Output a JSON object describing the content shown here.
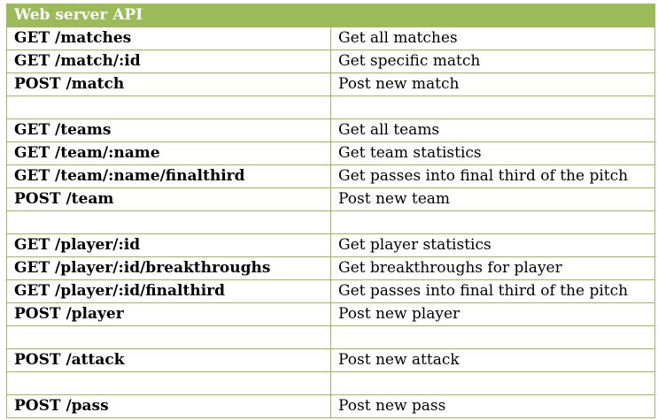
{
  "title": "Web server API",
  "accent_color": "#9bbb59",
  "rows": [
    {
      "route": "GET /matches",
      "desc": "Get all matches"
    },
    {
      "route": "GET /match/:id",
      "desc": "Get specific match"
    },
    {
      "route": "POST /match",
      "desc": "Post new match"
    },
    {
      "route": "",
      "desc": ""
    },
    {
      "route": "GET /teams",
      "desc": "Get all teams"
    },
    {
      "route": "GET /team/:name",
      "desc": "Get team statistics"
    },
    {
      "route": "GET /team/:name/finalthird",
      "desc": "Get passes into final third of the pitch"
    },
    {
      "route": "POST /team",
      "desc": "Post new team"
    },
    {
      "route": "",
      "desc": ""
    },
    {
      "route": "GET /player/:id",
      "desc": "Get player statistics"
    },
    {
      "route": "GET /player/:id/breakthroughs",
      "desc": "Get breakthroughs for player"
    },
    {
      "route": "GET /player/:id/finalthird",
      "desc": "Get passes into final third of the pitch"
    },
    {
      "route": "POST /player",
      "desc": "Post new player"
    },
    {
      "route": "",
      "desc": ""
    },
    {
      "route": "POST /attack",
      "desc": "Post new attack"
    },
    {
      "route": "",
      "desc": ""
    },
    {
      "route": "POST /pass",
      "desc": "Post new pass"
    }
  ]
}
